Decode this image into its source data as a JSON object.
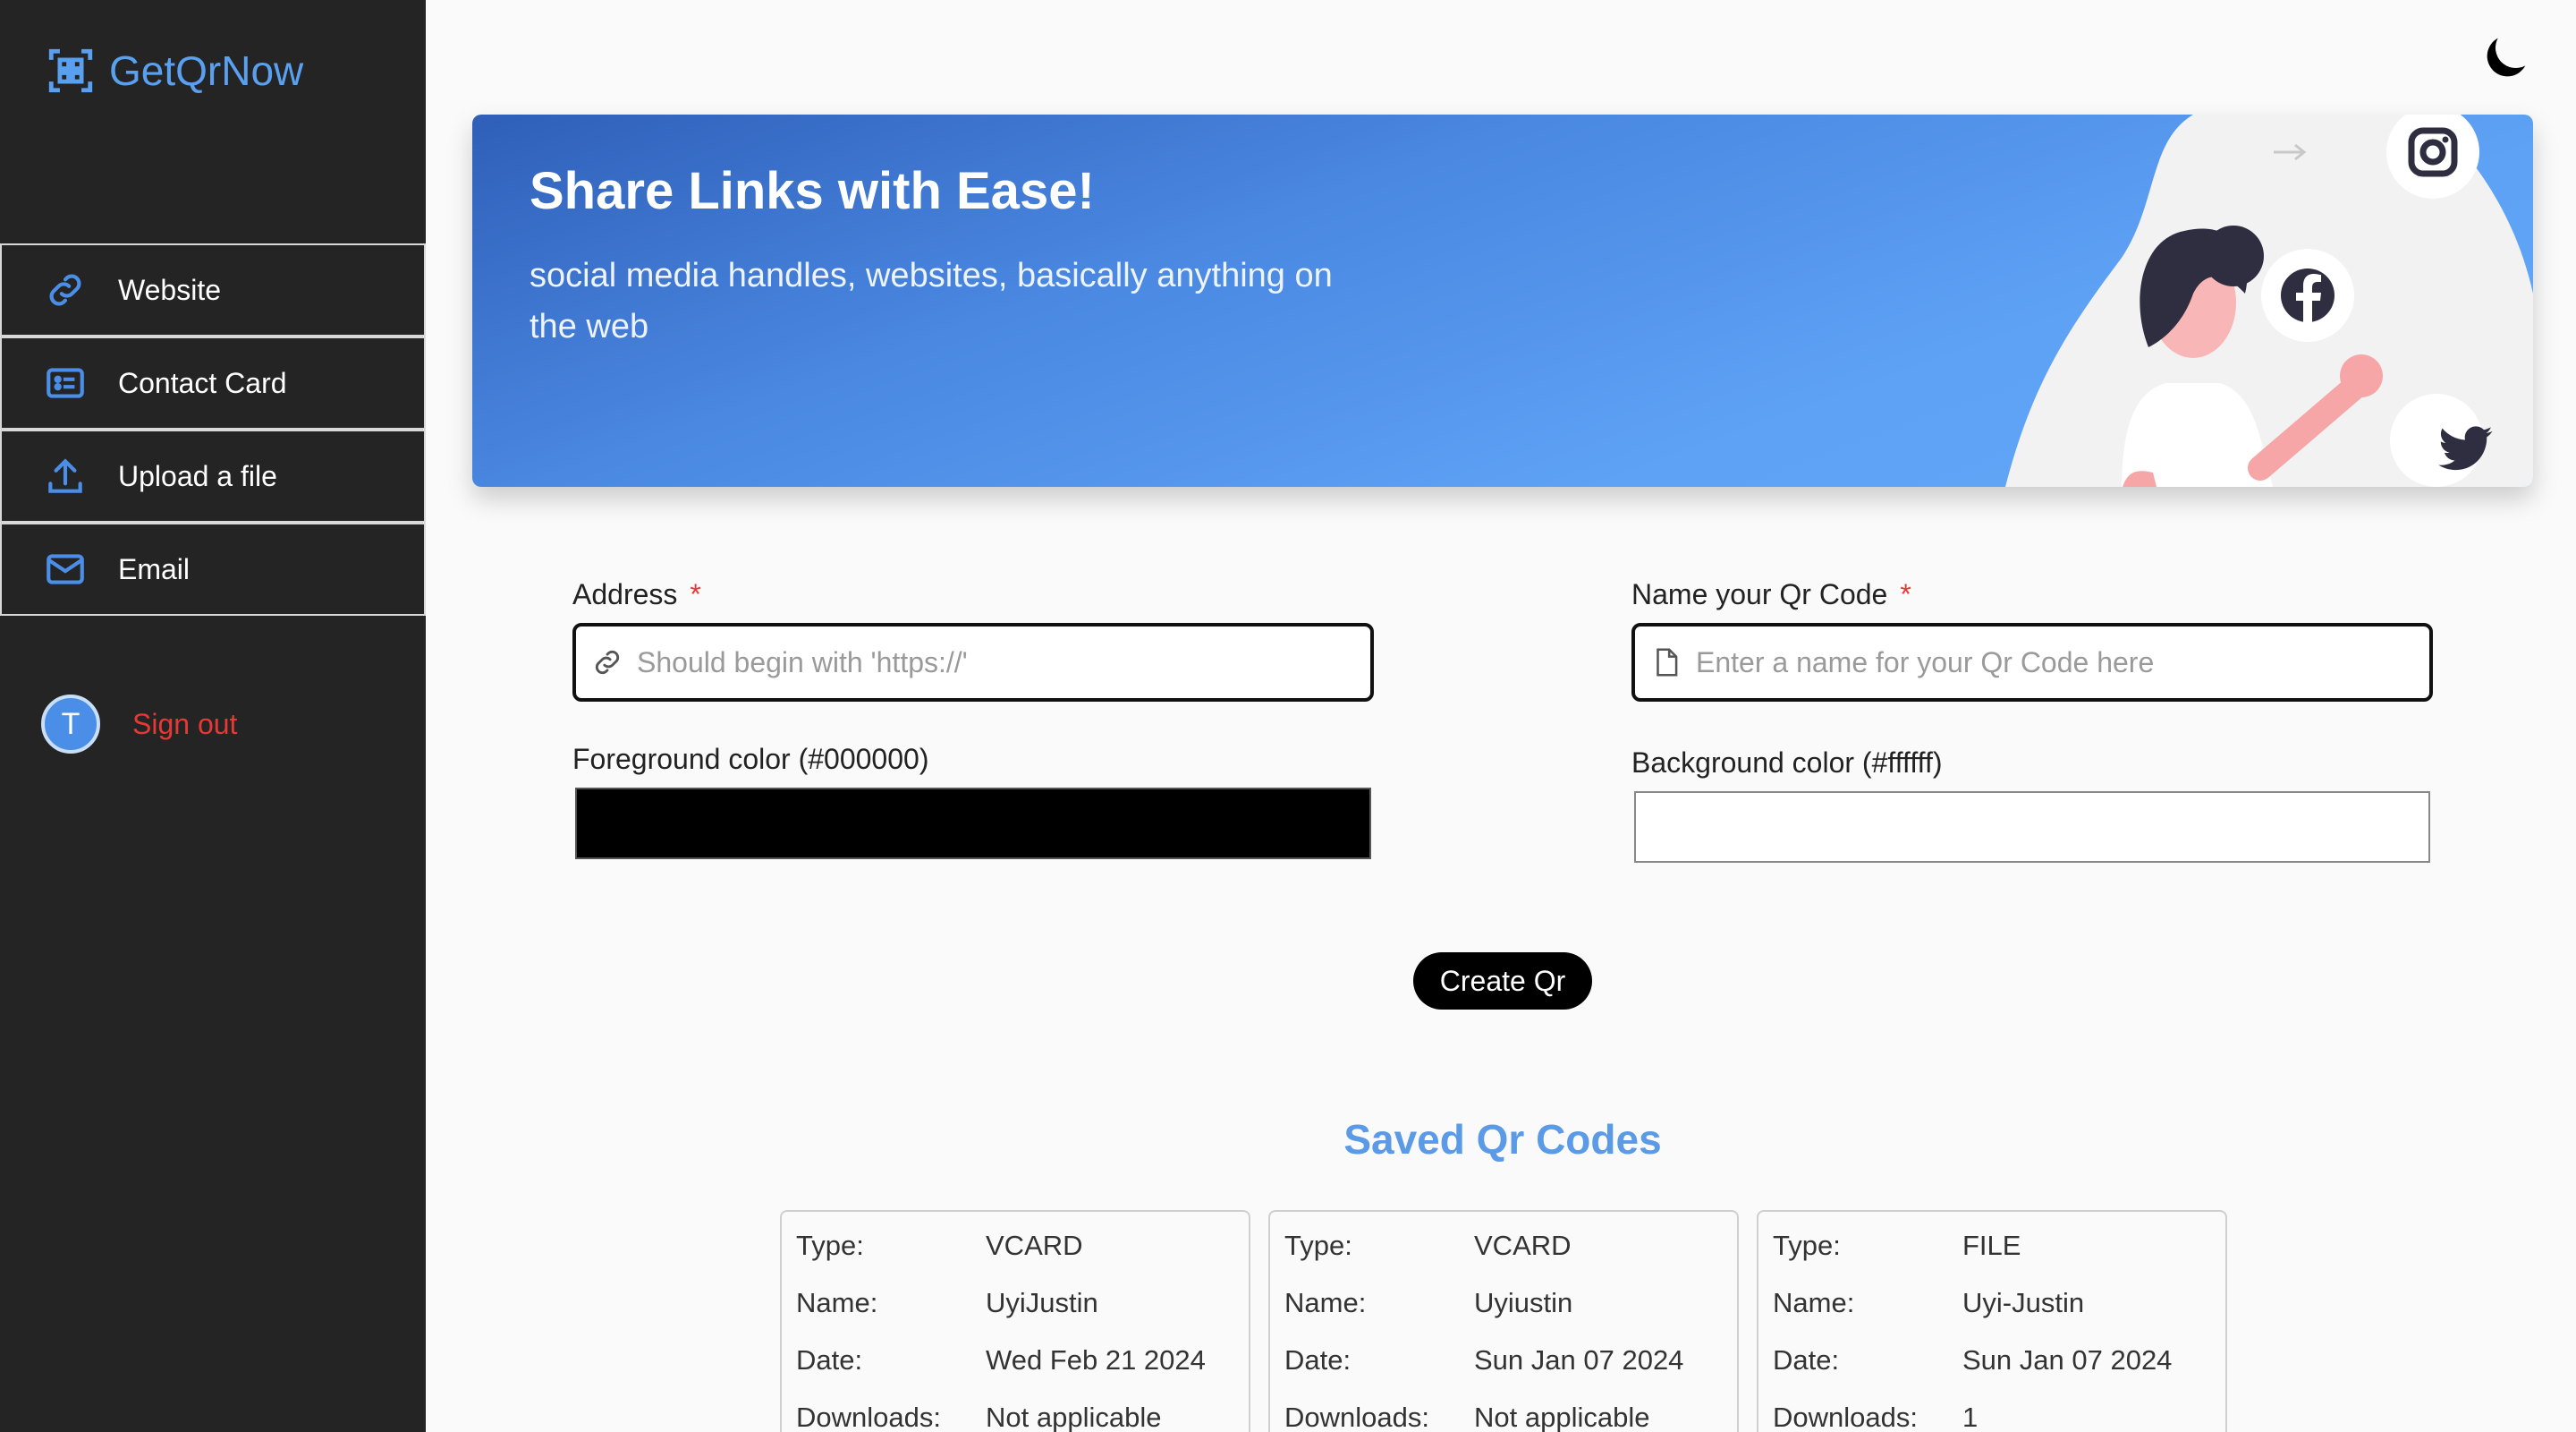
{
  "app": {
    "name": "GetQrNow"
  },
  "sidebar": {
    "items": [
      {
        "label": "Website",
        "icon": "link-icon"
      },
      {
        "label": "Contact Card",
        "icon": "contact-card-icon"
      },
      {
        "label": "Upload a file",
        "icon": "upload-icon"
      },
      {
        "label": "Email",
        "icon": "mail-icon"
      }
    ],
    "user_initial": "T",
    "signout_label": "Sign out"
  },
  "theme_toggle": {
    "icon": "moon-icon"
  },
  "banner": {
    "title": "Share Links with Ease!",
    "subtitle": "social media handles, websites, basically anything on the web",
    "icons": [
      "instagram-icon",
      "facebook-icon",
      "twitter-icon"
    ]
  },
  "form": {
    "address_label": "Address",
    "address_placeholder": "Should begin with 'https://'",
    "name_label": "Name your Qr Code",
    "name_placeholder": "Enter a name for your Qr Code here",
    "required_mark": "*",
    "fg_label": "Foreground color (#000000)",
    "fg_color": "#000000",
    "bg_label": "Background color (#ffffff)",
    "bg_color": "#ffffff",
    "create_label": "Create Qr"
  },
  "saved": {
    "title": "Saved Qr Codes",
    "keys": {
      "type": "Type:",
      "name": "Name:",
      "date": "Date:",
      "downloads": "Downloads:"
    },
    "cards": [
      {
        "type": "VCARD",
        "name": "UyiJustin",
        "date": "Wed Feb 21 2024",
        "downloads": "Not applicable"
      },
      {
        "type": "VCARD",
        "name": "Uyiustin",
        "date": "Sun Jan 07 2024",
        "downloads": "Not applicable"
      },
      {
        "type": "FILE",
        "name": "Uyi-Justin",
        "date": "Sun Jan 07 2024",
        "downloads": "1"
      }
    ]
  },
  "colors": {
    "accent": "#5a9ae6",
    "sidebar_bg": "#242424",
    "danger": "#e53935"
  }
}
